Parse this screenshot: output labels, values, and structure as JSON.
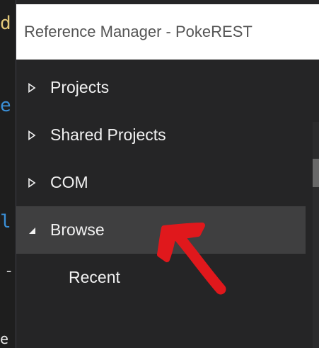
{
  "background_editor": {
    "fragments": [
      "d",
      "e",
      "l",
      "-",
      "e"
    ]
  },
  "dialog": {
    "title": "Reference Manager - PokeREST"
  },
  "tree": {
    "items": [
      {
        "label": "Projects",
        "expanded": false
      },
      {
        "label": "Shared Projects",
        "expanded": false
      },
      {
        "label": "COM",
        "expanded": false
      },
      {
        "label": "Browse",
        "expanded": true,
        "selected": true
      }
    ],
    "children": [
      {
        "label": "Recent"
      }
    ]
  },
  "icons": {
    "collapsed": "triangle-right-outline-icon",
    "expanded": "triangle-down-filled-icon",
    "annotation": "red-arrow-annotation"
  },
  "colors": {
    "dialog_background": "#252526",
    "selected_row": "#3f3f40",
    "text": "#f1f1f1",
    "title_bar": "#ffffff",
    "annotation": "#e0181c"
  }
}
